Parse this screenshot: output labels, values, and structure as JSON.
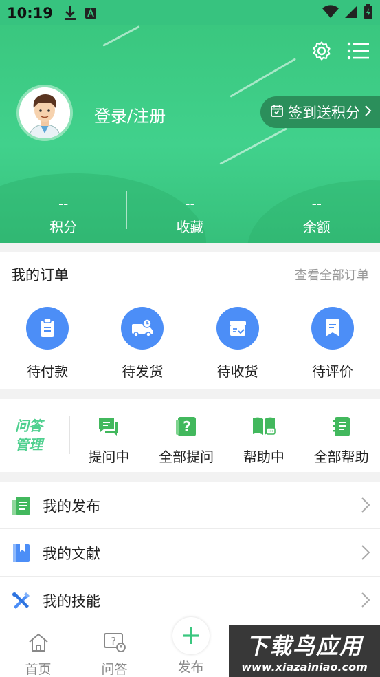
{
  "status_bar": {
    "time": "10:19"
  },
  "header": {
    "login_label": "登录/注册",
    "checkin_label": "签到送积分",
    "stats": [
      {
        "value": "--",
        "label": "积分"
      },
      {
        "value": "--",
        "label": "收藏"
      },
      {
        "value": "--",
        "label": "余额"
      }
    ]
  },
  "orders": {
    "title": "我的订单",
    "view_all": "查看全部订单",
    "items": [
      {
        "label": "待付款",
        "icon": "clipboard-icon"
      },
      {
        "label": "待发货",
        "icon": "delivery-truck-icon"
      },
      {
        "label": "待收货",
        "icon": "package-check-icon"
      },
      {
        "label": "待评价",
        "icon": "comment-icon"
      }
    ]
  },
  "qa": {
    "logo_line1": "问答",
    "logo_line2": "管理",
    "items": [
      {
        "label": "提问中",
        "icon": "chat-bubbles-icon"
      },
      {
        "label": "全部提问",
        "icon": "question-box-icon"
      },
      {
        "label": "帮助中",
        "icon": "open-book-chat-icon"
      },
      {
        "label": "全部帮助",
        "icon": "notebook-icon"
      }
    ]
  },
  "list": [
    {
      "label": "我的发布",
      "icon": "publish-document-icon"
    },
    {
      "label": "我的文献",
      "icon": "bookmark-book-icon"
    },
    {
      "label": "我的技能",
      "icon": "tools-icon"
    }
  ],
  "tabbar": {
    "items": [
      {
        "label": "首页",
        "icon": "home-icon"
      },
      {
        "label": "问答",
        "icon": "question-chat-icon"
      },
      {
        "label": "发布",
        "icon": "plus-icon"
      }
    ]
  },
  "watermark": {
    "line1": "下载鸟应用",
    "line2": "www.xiazainiao.com"
  },
  "colors": {
    "brand_green": "#3ac77f",
    "order_blue": "#4c8ef7",
    "checkin_bg": "#2b8f5b"
  }
}
